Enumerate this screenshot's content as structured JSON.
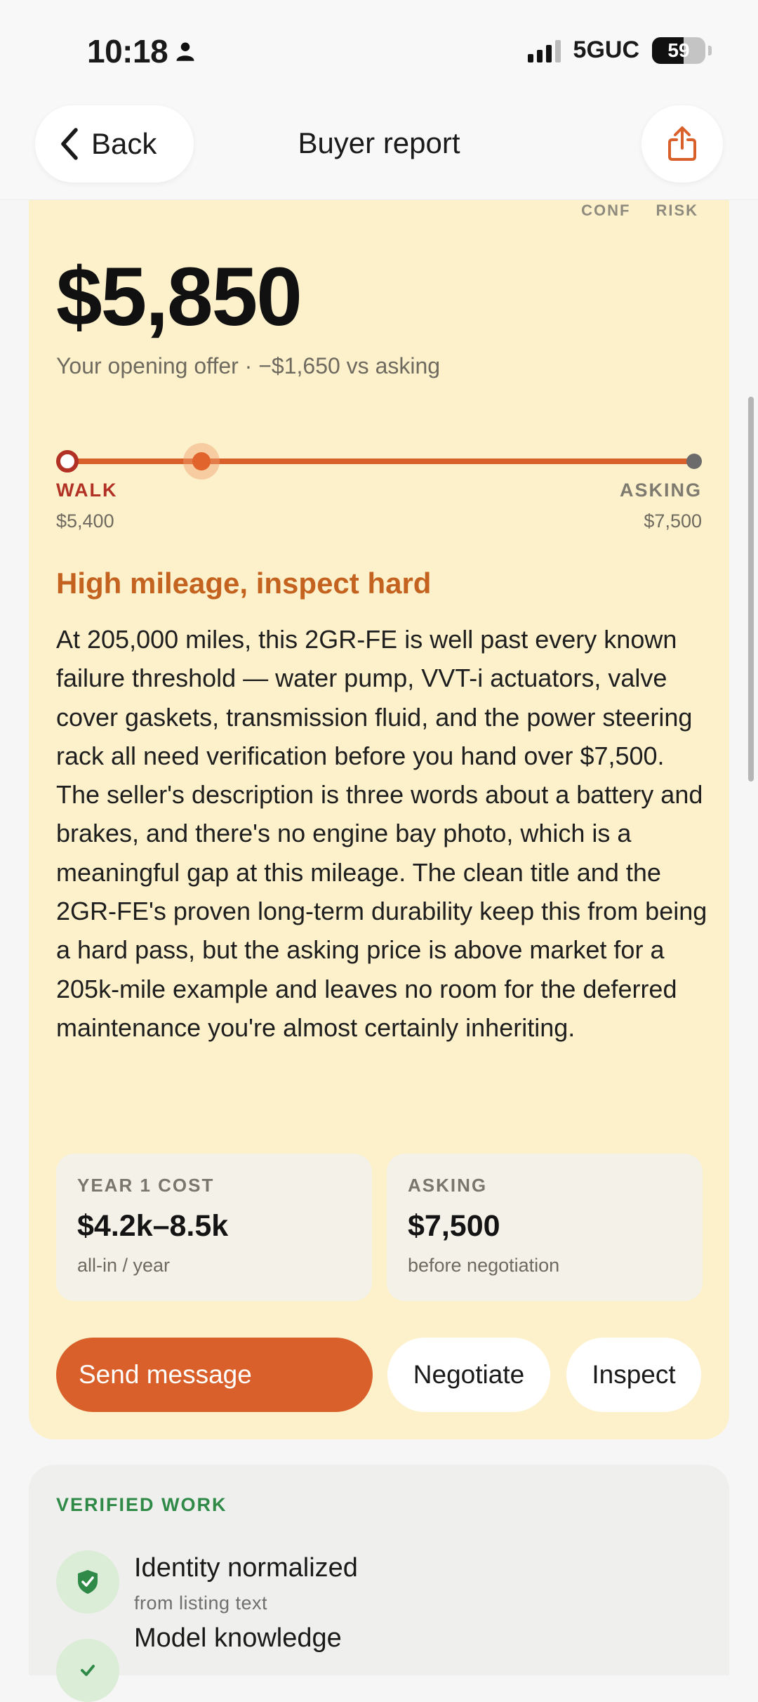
{
  "status_bar": {
    "time": "10:18",
    "network": "5GUC",
    "battery": "59"
  },
  "nav": {
    "back_label": "Back",
    "title": "Buyer report"
  },
  "report": {
    "conf_label": "CONF",
    "risk_label": "RISK",
    "offer_price": "$5,850",
    "offer_subtitle": "Your opening offer · −$1,650 vs asking",
    "range": {
      "walk_label": "WALK",
      "walk_value": "$5,400",
      "asking_label": "ASKING",
      "asking_value": "$7,500",
      "offer_position": 0.214
    },
    "verdict": "High mileage, inspect hard",
    "summary": "At 205,000 miles, this 2GR-FE is well past every known failure threshold — water pump, VVT-i actuators, valve cover gaskets, transmission fluid, and the power steering rack all need verification before you hand over $7,500. The seller's description is three words about a battery and brakes, and there's no engine bay photo, which is a meaningful gap at this mileage. The clean title and the 2GR-FE's proven long-term durability keep this from being a hard pass, but the asking price is above market for a 205k-mile example and leaves no room for the deferred maintenance you're almost certainly inheriting.",
    "stats": [
      {
        "label": "YEAR 1 COST",
        "value": "$4.2k–8.5k",
        "note": "all-in / year"
      },
      {
        "label": "ASKING",
        "value": "$7,500",
        "note": "before negotiation"
      }
    ],
    "actions": {
      "send": "Send message",
      "negotiate": "Negotiate",
      "inspect": "Inspect"
    }
  },
  "verified_work": {
    "title": "VERIFIED WORK",
    "items": [
      {
        "title": "Identity normalized",
        "subtitle": "from listing text"
      },
      {
        "title": "Model knowledge",
        "subtitle": ""
      }
    ]
  },
  "colors": {
    "accent": "#d9602a",
    "walk": "#b23125",
    "card_bg": "#fdf1cb",
    "verified_green": "#2f8a48"
  }
}
